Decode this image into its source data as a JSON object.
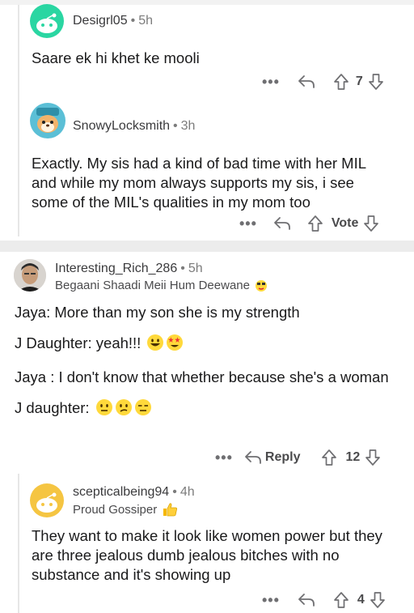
{
  "comments": [
    {
      "username": "Desigrl05",
      "time": "5h",
      "body": [
        "Saare ek hi khet ke mooli"
      ],
      "votes": "7",
      "avatar_color": "#2ad6a2"
    },
    {
      "username": "SnowyLocksmith",
      "time": "3h",
      "body": [
        "Exactly. My sis had a kind of bad time with her MIL and while my mom always supports my sis, i see some of the MIL's qualities in my mom too"
      ],
      "votes": "Vote",
      "avatar_color": "#5bbfd6"
    },
    {
      "username": "Interesting_Rich_286",
      "time": "5h",
      "flair": "Begaani Shaadi Meii Hum Deewane",
      "body": [
        "Jaya: More than my son she is my strength",
        "J Daughter: yeah!!!",
        "Jaya : I don't know that whether because she's a woman",
        "J daughter:"
      ],
      "reply_label": "Reply",
      "votes": "12"
    },
    {
      "username": "scepticalbeing94",
      "time": "4h",
      "flair": "Proud Gossiper",
      "body": [
        "They want to make it look like women power but they  are three jealous dumb jealous bitches with no substance and it's showing up"
      ],
      "votes": "4",
      "avatar_color": "#f5c542"
    }
  ],
  "separator": "•",
  "more_label": "•••",
  "icons": [
    "more-icon",
    "reply-icon",
    "upvote-icon",
    "downvote-icon",
    "snoo-icon",
    "emoji-icon"
  ],
  "colors": {
    "divider": "#ececec",
    "meta": "#7c7c7c",
    "text": "#1a1a1b"
  }
}
